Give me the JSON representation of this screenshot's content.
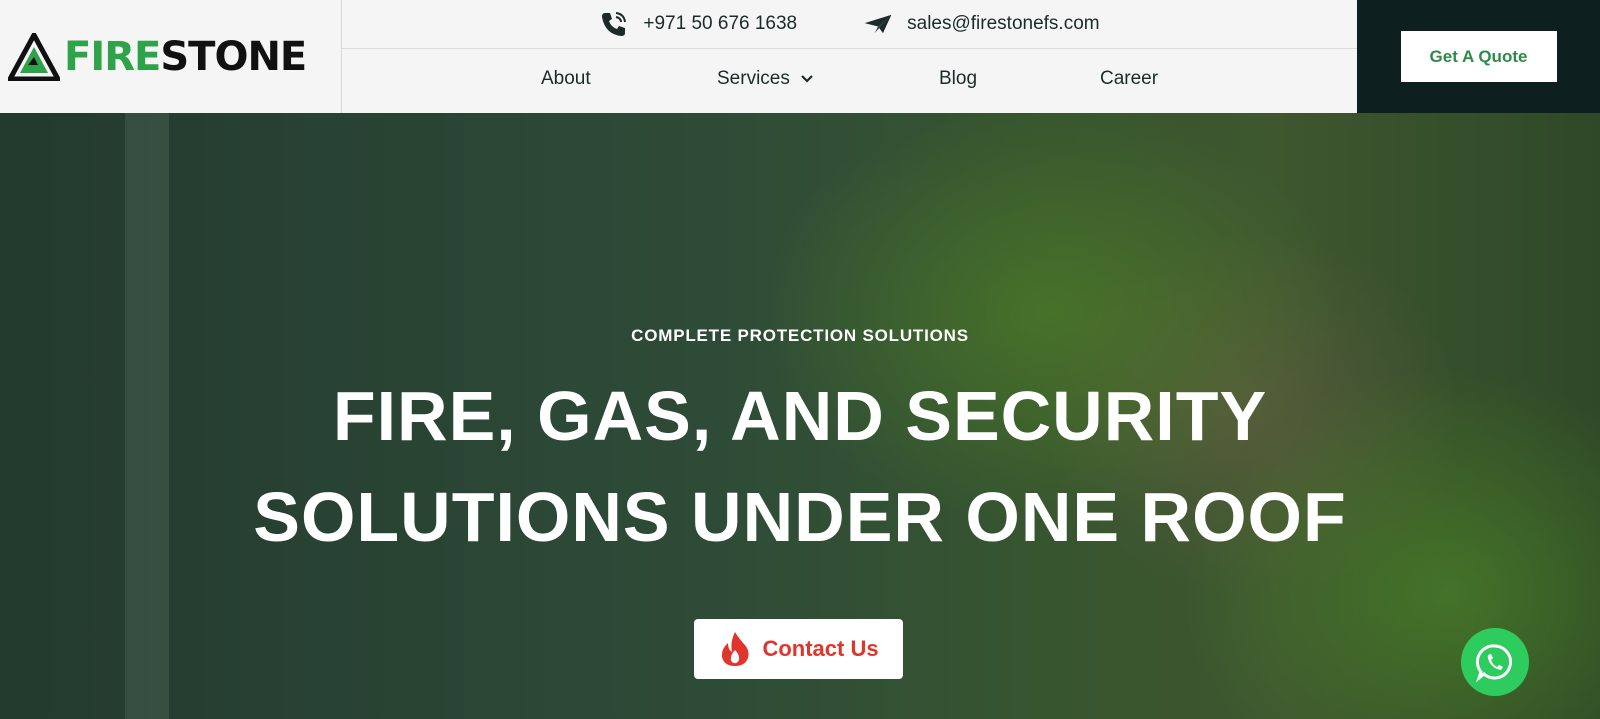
{
  "brand": {
    "name_part1": "FIRE",
    "name_part2": "STONE",
    "accent_color": "#2ea34a",
    "dark_color": "#0e1f1f"
  },
  "contact": {
    "phone": "+971 50 676 1638",
    "phone_icon": "phone-icon",
    "email": "sales@firestonefs.com",
    "email_icon": "paper-plane-icon"
  },
  "nav": {
    "items": [
      {
        "label": "About"
      },
      {
        "label": "Services",
        "has_dropdown": true
      },
      {
        "label": "Blog"
      },
      {
        "label": "Career"
      }
    ]
  },
  "cta": {
    "quote_label": "Get A Quote"
  },
  "hero": {
    "eyebrow": "COMPLETE PROTECTION SOLUTIONS",
    "headline_line1": "FIRE, GAS, AND SECURITY",
    "headline_line2": "SOLUTIONS UNDER ONE ROOF",
    "button_label": "Contact Us",
    "button_icon": "flame-icon",
    "button_color": "#e0352c"
  },
  "floating": {
    "icon": "whatsapp-icon",
    "color": "#2ecc5e"
  }
}
